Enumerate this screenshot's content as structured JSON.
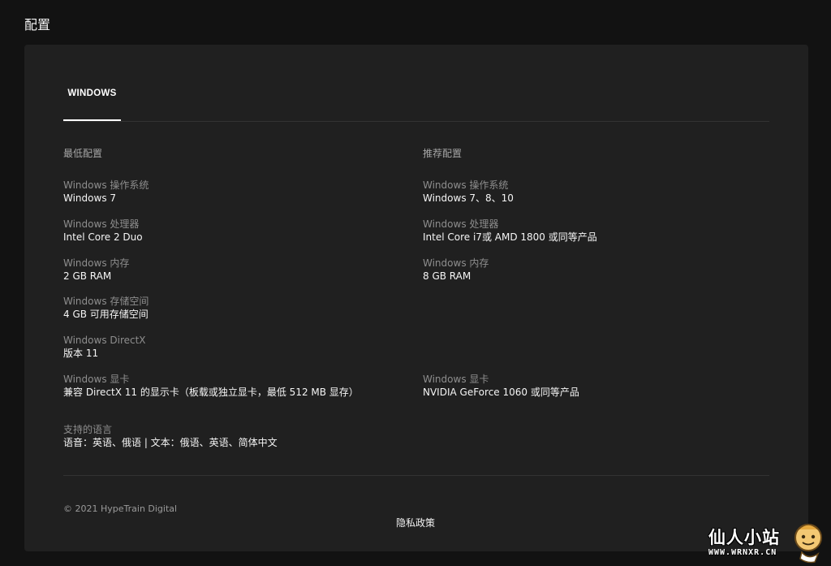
{
  "header": {
    "title": "配置"
  },
  "tabs": [
    {
      "label": "WINDOWS"
    }
  ],
  "minimum": {
    "heading": "最低配置",
    "specs": [
      {
        "label": "Windows 操作系统",
        "value": "Windows 7"
      },
      {
        "label": "Windows 处理器",
        "value": "Intel Core 2 Duo"
      },
      {
        "label": "Windows 内存",
        "value": "2 GB RAM"
      },
      {
        "label": "Windows 存储空间",
        "value": "4 GB 可用存储空间"
      },
      {
        "label": "Windows DirectX",
        "value": "版本 11"
      },
      {
        "label": "Windows 显卡",
        "value": "兼容 DirectX 11 的显示卡（板载或独立显卡，最低 512 MB 显存）"
      }
    ]
  },
  "recommended": {
    "heading": "推荐配置",
    "specs": [
      {
        "label": "Windows 操作系统",
        "value": "Windows 7、8、10"
      },
      {
        "label": "Windows 处理器",
        "value": "Intel Core i7或 AMD 1800 或同等产品"
      },
      {
        "label": "Windows 内存",
        "value": "8 GB RAM"
      },
      {
        "label": "Windows 显卡",
        "value": "NVIDIA GeForce 1060 或同等产品"
      }
    ]
  },
  "languages": {
    "label": "支持的语言",
    "value": "语音：英语、俄语 | 文本：俄语、英语、简体中文"
  },
  "footer": {
    "copyright": "© 2021 HypeTrain Digital",
    "privacy_label": "隐私政策"
  },
  "watermark": {
    "text": "仙人小站",
    "url": "WWW.WRNXR.CN"
  }
}
